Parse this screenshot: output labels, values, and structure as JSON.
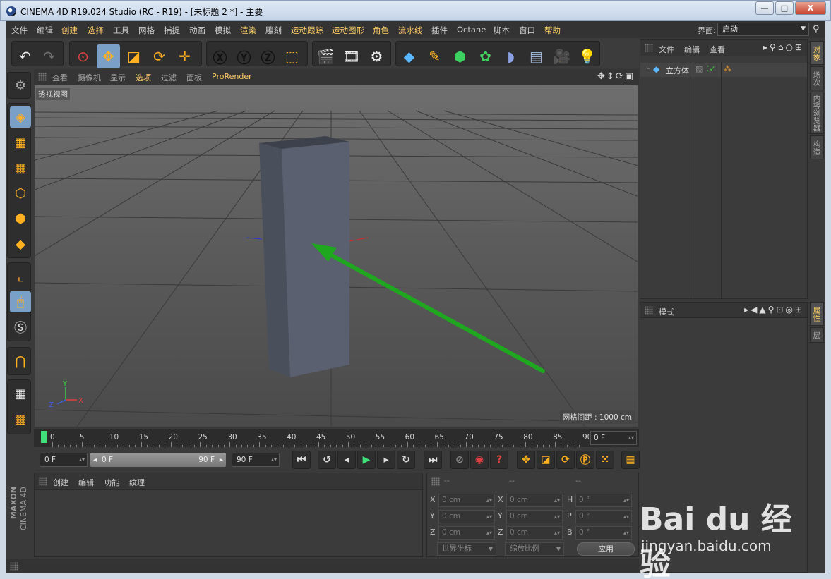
{
  "window": {
    "title": "CINEMA 4D R19.024 Studio (RC - R19) - [未标题 2 *] - 主要",
    "min_label": "—",
    "max_label": "□",
    "close_label": "X"
  },
  "menu": {
    "items": [
      "文件",
      "编辑",
      "创建",
      "选择",
      "工具",
      "网格",
      "捕捉",
      "动画",
      "模拟",
      "渲染",
      "雕刻",
      "运动跟踪",
      "运动图形",
      "角色",
      "流水线",
      "插件",
      "Octane",
      "脚本",
      "窗口",
      "帮助"
    ],
    "layout_label": "界面:",
    "layout_value": "启动"
  },
  "viewport": {
    "menu": [
      "查看",
      "摄像机",
      "显示",
      "选项",
      "过滤",
      "面板",
      "ProRender"
    ],
    "label": "透视视图",
    "grid_spacing": "网格间距 : 1000 cm",
    "axis_x": "X",
    "axis_y": "Y",
    "axis_z": "Z"
  },
  "timeline": {
    "ticks": [
      "0",
      "5",
      "10",
      "15",
      "20",
      "25",
      "30",
      "35",
      "40",
      "45",
      "50",
      "55",
      "60",
      "65",
      "70",
      "75",
      "80",
      "85",
      "90"
    ],
    "current_frame": "0 F"
  },
  "transport": {
    "start_frame": "0 F",
    "range_start": "0 F",
    "range_end": "90 F",
    "end_frame": "90 F"
  },
  "material": {
    "menu": [
      "创建",
      "编辑",
      "功能",
      "纹理"
    ]
  },
  "coords": {
    "headers": [
      "--",
      "--",
      "--"
    ],
    "rows": [
      {
        "l1": "X",
        "v1": "0 cm",
        "l2": "X",
        "v2": "0 cm",
        "l3": "H",
        "v3": "0 °"
      },
      {
        "l1": "Y",
        "v1": "0 cm",
        "l2": "Y",
        "v2": "0 cm",
        "l3": "P",
        "v3": "0 °"
      },
      {
        "l1": "Z",
        "v1": "0 cm",
        "l2": "Z",
        "v2": "0 cm",
        "l3": "B",
        "v3": "0 °"
      }
    ],
    "world_coords": "世界坐标",
    "scale_ratio": "缩放比例",
    "apply": "应用"
  },
  "object_manager": {
    "menu": [
      "文件",
      "编辑",
      "查看"
    ],
    "objects": [
      {
        "name": "立方体"
      }
    ]
  },
  "attribute_manager": {
    "menu": [
      "模式"
    ]
  },
  "right_tabs": [
    "对象",
    "场次",
    "内容浏览器",
    "构造"
  ],
  "right_tabs_lower": [
    "属性",
    "层"
  ],
  "branding": {
    "maxon": "MAXON",
    "cinema": "CINEMA 4D"
  },
  "watermark": {
    "brand": "Bai du 经验",
    "url": "jingyan.baidu.com"
  },
  "colors": {
    "accent": "#ffcc66",
    "active_tool": "#7aa0c8",
    "arrow": "#1fa81f",
    "playhead": "#3fe07a",
    "cube": "#5a6070"
  }
}
